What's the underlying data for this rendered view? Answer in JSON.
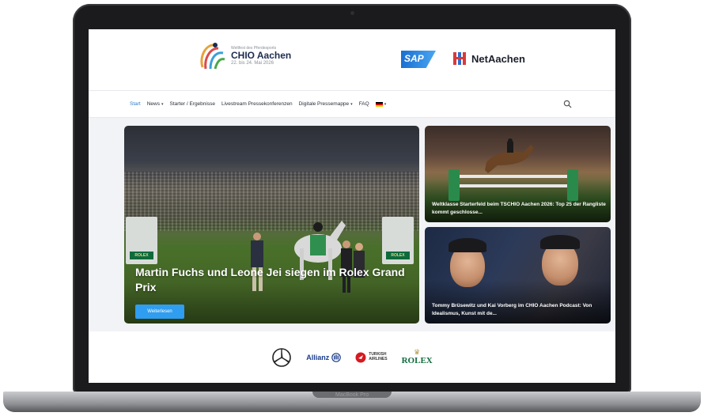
{
  "header": {
    "logo_sub": "Weltfest des Pferdesports",
    "logo_title": "CHIO Aachen",
    "logo_date": "22. bis 24. Mai 2026",
    "sponsor_sap": "SAP",
    "sponsor_net": "NetAachen"
  },
  "nav": {
    "items": [
      {
        "label": "Start",
        "active": true
      },
      {
        "label": "News",
        "dropdown": true
      },
      {
        "label": "Starter / Ergebnisse"
      },
      {
        "label": "Livestream Pressekonferenzen"
      },
      {
        "label": "Digitale Pressemappe",
        "dropdown": true
      },
      {
        "label": "FAQ"
      }
    ],
    "language_icon": "germany-flag-icon",
    "search_icon": "search-icon"
  },
  "main_story": {
    "title": "Martin Fuchs und Leone Jei siegen im Rolex Grand Prix",
    "button_label": "Weiterlesen",
    "pillar_tag": "ROLEX"
  },
  "side_stories": [
    {
      "title": "Weltklasse Starterfeld beim TSCHIO Aachen 2026: Top 25 der Rangliste kommt geschlosse..."
    },
    {
      "title": "Tommy Brüsewitz und Kai Vorberg im CHIO Aachen Podcast: Von Idealismus, Kunst mit de..."
    }
  ],
  "sponsors": {
    "allianz": "Allianz",
    "turkish_line1": "TURKISH",
    "turkish_line2": "AIRLINES",
    "rolex": "ROLEX"
  },
  "device_label": "MacBook Pro",
  "colors": {
    "accent": "#2f7ec4",
    "button": "#2f9df0",
    "rolex_green": "#0f6b3c"
  }
}
